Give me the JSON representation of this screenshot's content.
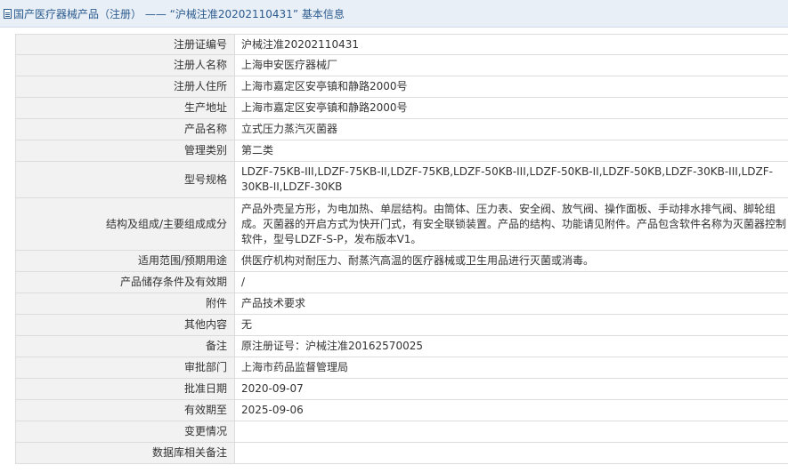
{
  "header": {
    "icon": "document-icon",
    "title": "国产医疗器械产品（注册） —— “沪械注准20202110431” 基本信息"
  },
  "fields": [
    {
      "label": "注册证编号",
      "value": "沪械注准20202110431"
    },
    {
      "label": "注册人名称",
      "value": "上海申安医疗器械厂"
    },
    {
      "label": "注册人住所",
      "value": "上海市嘉定区安亭镇和静路2000号"
    },
    {
      "label": "生产地址",
      "value": "上海市嘉定区安亭镇和静路2000号"
    },
    {
      "label": "产品名称",
      "value": "立式压力蒸汽灭菌器"
    },
    {
      "label": "管理类别",
      "value": "第二类"
    },
    {
      "label": "型号规格",
      "value": "LDZF-75KB-III,LDZF-75KB-II,LDZF-75KB,LDZF-50KB-III,LDZF-50KB-II,LDZF-50KB,LDZF-30KB-III,LDZF-30KB-II,LDZF-30KB"
    },
    {
      "label": "结构及组成/主要组成成分",
      "value": "产品外壳呈方形，为电加热、单层结构。由筒体、压力表、安全阀、放气阀、操作面板、手动排水排气阀、脚轮组成。灭菌器的开启方式为快开门式，有安全联锁装置。产品的结构、功能请见附件。产品包含软件名称为灭菌器控制软件，型号LDZF-S-P，发布版本V1。"
    },
    {
      "label": "适用范围/预期用途",
      "value": "供医疗机构对耐压力、耐蒸汽高温的医疗器械或卫生用品进行灭菌或消毒。"
    },
    {
      "label": "产品储存条件及有效期",
      "value": "/"
    },
    {
      "label": "附件",
      "value": "产品技术要求"
    },
    {
      "label": "其他内容",
      "value": "无"
    },
    {
      "label": "备注",
      "value": "原注册证号：沪械注准20162570025"
    },
    {
      "label": "审批部门",
      "value": "上海市药品监督管理局"
    },
    {
      "label": "批准日期",
      "value": "2020-09-07"
    },
    {
      "label": "有效期至",
      "value": "2025-09-06"
    },
    {
      "label": "变更情况",
      "value": ""
    },
    {
      "label": "数据库相关备注",
      "value": ""
    }
  ]
}
